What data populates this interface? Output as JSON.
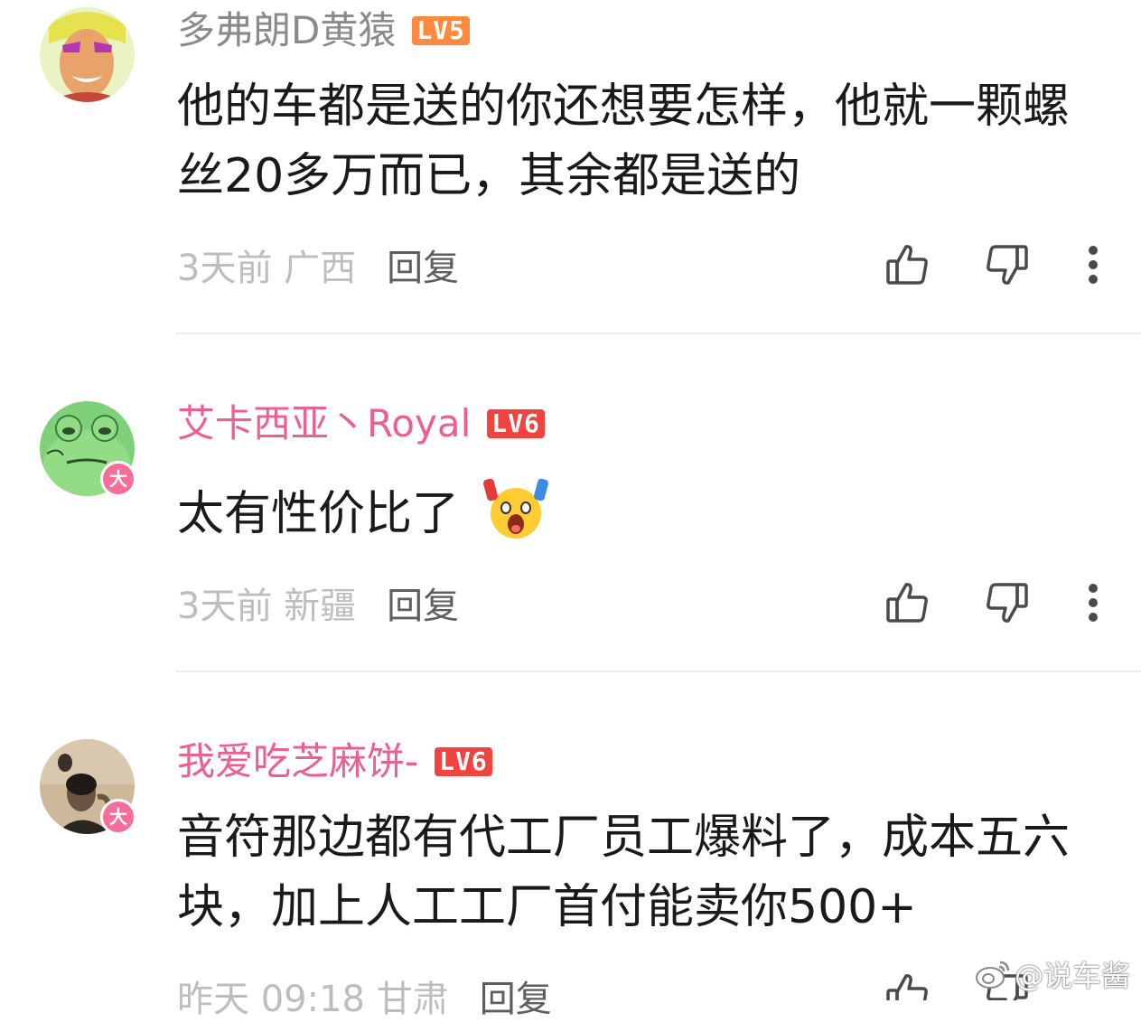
{
  "comments": [
    {
      "username": "多弗朗D黄猿",
      "level": "LV5",
      "content": "他的车都是送的你还想要怎样，他就一颗螺丝20多万而已，其余都是送的",
      "time_location": "3天前 广西",
      "reply_label": "回复"
    },
    {
      "username": "艾卡西亚丶Royal",
      "level": "LV6",
      "vip_badge": "大",
      "content": "太有性价比了",
      "emoji": "shocked-emoji",
      "time_location": "3天前 新疆",
      "reply_label": "回复"
    },
    {
      "username": "我爱吃芝麻饼-",
      "level": "LV6",
      "vip_badge": "大",
      "content": "音符那边都有代工厂员工爆料了，成本五六块，加上人工工厂首付能卖你500+",
      "time_location": "昨天 09:18 甘肃",
      "reply_label": "回复"
    }
  ],
  "icons": {
    "like": "thumbs-up-icon",
    "dislike": "thumbs-down-icon",
    "more": "more-vertical-icon"
  },
  "watermark": {
    "text": "@说车酱",
    "icon": "weibo-logo-icon"
  },
  "colors": {
    "username_gray": "#8a8a8a",
    "username_pink": "#ec5f8e",
    "lv5_badge": "#ff8a3d",
    "lv6_badge": "#f2443f",
    "vip_badge": "#f56e9a",
    "meta_text": "#bdbdbd",
    "reply_text": "#5e5e5e"
  }
}
